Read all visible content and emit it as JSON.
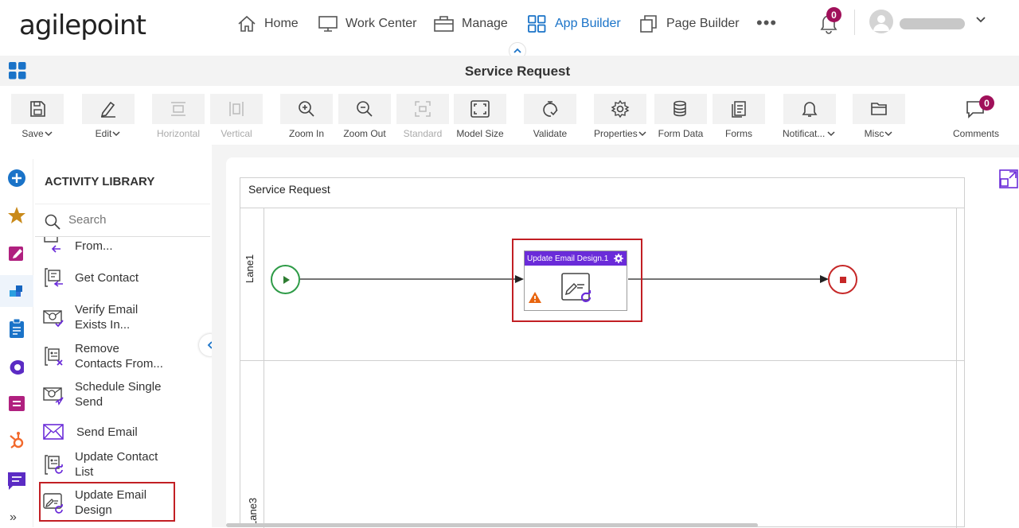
{
  "brand": {
    "logo_text": "agilepoint"
  },
  "top_nav": {
    "home": "Home",
    "work_center": "Work Center",
    "manage": "Manage",
    "app_builder": "App Builder",
    "page_builder": "Page Builder",
    "more": "•••",
    "notifications_count": "0",
    "active_item": "App Builder"
  },
  "title_bar": {
    "title": "Service Request"
  },
  "toolbar": {
    "save": "Save",
    "edit": "Edit",
    "horizontal": "Horizontal",
    "vertical": "Vertical",
    "zoom_in": "Zoom In",
    "zoom_out": "Zoom Out",
    "standard": "Standard",
    "model_size": "Model Size",
    "validate": "Validate",
    "properties": "Properties",
    "form_data": "Form Data",
    "forms": "Forms",
    "notifications": "Notificat...",
    "misc": "Misc",
    "comments": "Comments",
    "comments_count": "0"
  },
  "activity_library": {
    "title": "ACTIVITY LIBRARY",
    "search_placeholder": "Search",
    "items": [
      {
        "label": "From..."
      },
      {
        "label": "Get Contact"
      },
      {
        "label": "Verify Email",
        "label2": "Exists In..."
      },
      {
        "label": "Remove",
        "label2": "Contacts From..."
      },
      {
        "label": "Schedule Single",
        "label2": "Send"
      },
      {
        "label": "Send Email"
      },
      {
        "label": "Update Contact",
        "label2": "List"
      },
      {
        "label": "Update Email",
        "label2": "Design"
      }
    ],
    "more_glyph": "»"
  },
  "canvas": {
    "pool_title": "Service Request",
    "lanes": [
      "Lane1",
      "Lane3"
    ],
    "activity": {
      "title": "Update Email Design.1",
      "warning": true
    }
  },
  "colors": {
    "accent_blue": "#1a73c8",
    "badge": "#a0105a",
    "activity_header": "#6a2bd9",
    "highlight_red": "#c21f24",
    "start_green": "#2e9b47",
    "end_red": "#c62828"
  }
}
